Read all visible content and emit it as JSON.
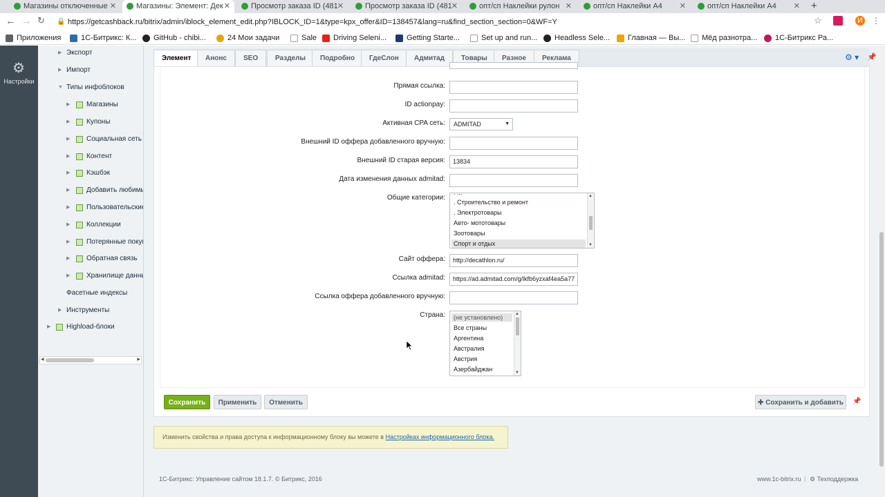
{
  "browser": {
    "tabs": [
      {
        "title": "Магазины отключенные",
        "fav": "#2e9d3a",
        "active": false
      },
      {
        "title": "Магазины: Элемент: Дек",
        "fav": "#2e9d3a",
        "active": true
      },
      {
        "title": "Просмотр заказа ID (481",
        "fav": "#2e9d3a",
        "active": false
      },
      {
        "title": "Просмотр заказа ID (481",
        "fav": "#2e9d3a",
        "active": false
      },
      {
        "title": "опт/сп Наклейки рулон",
        "fav": "#2e9d3a",
        "active": false
      },
      {
        "title": "опт/сп Наклейки А4",
        "fav": "#2e9d3a",
        "active": false
      },
      {
        "title": "опт/сп Наклейки А4",
        "fav": "#2e9d3a",
        "active": false
      }
    ],
    "new_tab": "+",
    "url": "https://getcashback.ru/bitrix/admin/iblock_element_edit.php?IBLOCK_ID=1&type=kpx_offer&ID=138457&lang=ru&find_section_section=0&WF=Y",
    "profile_initial": "И",
    "bookmarks": [
      {
        "label": "Приложения",
        "color": "#5f6368"
      },
      {
        "label": "1С-Битрикс: К...",
        "color": "#2d6cb1"
      },
      {
        "label": "GitHub - chibi...",
        "color": "#222222"
      },
      {
        "label": "24  Мои задачи",
        "color": "#e8a400"
      },
      {
        "label": "Sale",
        "color": "#9aa0a6"
      },
      {
        "label": "Driving Seleni...",
        "color": "#e62117"
      },
      {
        "label": "Getting Starte...",
        "color": "#1a3c6e"
      },
      {
        "label": "Set up and run...",
        "color": "#9aa0a6"
      },
      {
        "label": "Headless Sele...",
        "color": "#222222"
      },
      {
        "label": "Главная — Вы...",
        "color": "#f0a500"
      },
      {
        "label": "Мёд разнотра...",
        "color": "#9aa0a6"
      },
      {
        "label": "1С-Битрикс Ра...",
        "color": "#c2185b"
      }
    ]
  },
  "rail": {
    "settings_label": "Настройки"
  },
  "sidebar": {
    "items": [
      {
        "label": "Экспорт",
        "level": 1,
        "arrow": "▶"
      },
      {
        "label": "Импорт",
        "level": 1,
        "arrow": "▶"
      },
      {
        "label": "Типы инфоблоков",
        "level": 1,
        "arrow": "▼"
      },
      {
        "label": "Магазины",
        "level": 2,
        "arrow": "▶"
      },
      {
        "label": "Купоны",
        "level": 2,
        "arrow": "▶"
      },
      {
        "label": "Социальная сеть",
        "level": 2,
        "arrow": "▶"
      },
      {
        "label": "Контент",
        "level": 2,
        "arrow": "▶"
      },
      {
        "label": "Кэшбэк",
        "level": 2,
        "arrow": "▶"
      },
      {
        "label": "Добавить любимый",
        "level": 2,
        "arrow": "▶"
      },
      {
        "label": "Пользовательские д",
        "level": 2,
        "arrow": "▶"
      },
      {
        "label": "Коллекции",
        "level": 2,
        "arrow": "▶"
      },
      {
        "label": "Потерянные покупк",
        "level": 2,
        "arrow": "▶"
      },
      {
        "label": "Обратная связь",
        "level": 2,
        "arrow": "▶"
      },
      {
        "label": "Хранилище данных",
        "level": 2,
        "arrow": "▶"
      },
      {
        "label": "Фасетные индексы",
        "level": 1,
        "arrow": ""
      },
      {
        "label": "Инструменты",
        "level": 1,
        "arrow": "▶"
      },
      {
        "label": "Highload-блоки",
        "level": 0,
        "arrow": "▶"
      }
    ]
  },
  "form_tabs": [
    "Элемент",
    "Анонс",
    "SEO",
    "Разделы",
    "Подробно",
    "ГдеСлон",
    "Адмитад",
    "Товары",
    "Разное",
    "Реклама"
  ],
  "fields": {
    "direct_link_label": "Прямая ссылка:",
    "actionpay_label": "ID actionpay:",
    "cpa_label": "Активная CPA сеть:",
    "cpa_value": "ADMITAD",
    "ext_id_manual_label": "Внешний ID оффера добавленного вручную:",
    "ext_id_old_label": "Внешний ID старая версия:",
    "ext_id_old_value": "13834",
    "admitad_date_label": "Дата изменения данных admitad:",
    "categories_label": "Общие категории:",
    "categories": [
      ". Строительство и ремонт",
      ". Электротовары",
      "Авто- мототовары",
      "Зоотовары",
      "Спорт и отдых"
    ],
    "site_label": "Сайт оффера:",
    "site_value": "http://decathlon.ru/",
    "admitad_link_label": "Ссылка admitad:",
    "admitad_link_value": "https://ad.admitad.com/g/lkfb6yzxaf4ea5a77",
    "manual_link_label": "Ссылка оффера добавленного вручную:",
    "country_label": "Страна:",
    "countries": [
      "(не установлено)",
      "Все страны",
      "Аргентина",
      "Австралия",
      "Австрия",
      "Азербайджан"
    ]
  },
  "buttons": {
    "save": "Сохранить",
    "apply": "Применить",
    "cancel": "Отменить",
    "save_add": "Сохранить и добавить"
  },
  "notice": {
    "text": "Изменить свойства и права доступа к информационному блоку вы можете в ",
    "link": "Настройках информационного блока."
  },
  "footer": {
    "copyright": "1С-Битрикс: Управление сайтом 18.1.7. © Битрикс, 2016",
    "site_link": "www.1c-bitrix.ru",
    "separator": "|",
    "support": "Техподдержка"
  }
}
